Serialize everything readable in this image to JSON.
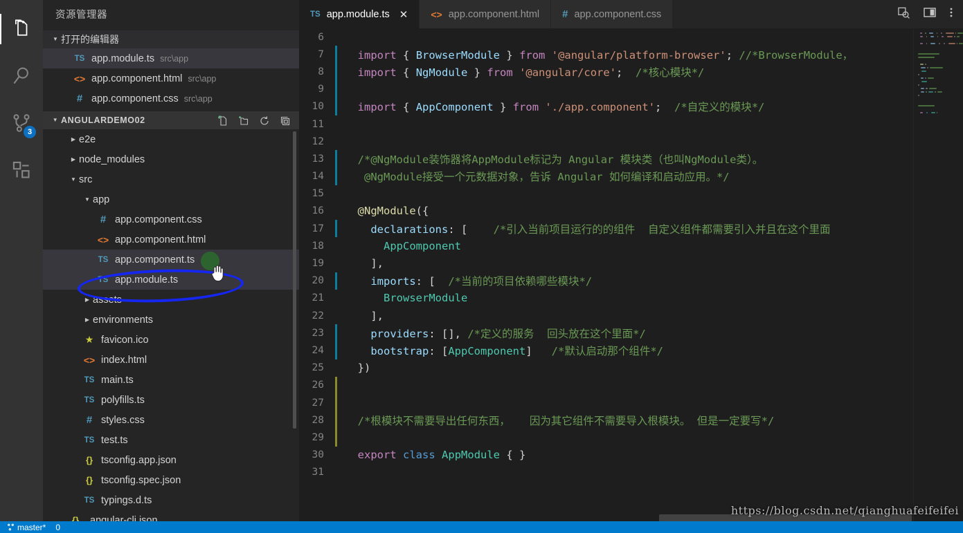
{
  "activity_bar": {
    "items": [
      {
        "name": "explorer",
        "icon": "files-icon",
        "active": true
      },
      {
        "name": "search",
        "icon": "search-icon",
        "active": false
      },
      {
        "name": "source-control",
        "icon": "source-control-icon",
        "active": false,
        "badge": "3"
      },
      {
        "name": "extensions",
        "icon": "extensions-icon",
        "active": false
      }
    ]
  },
  "sidebar": {
    "title": "资源管理器",
    "open_editors": {
      "label": "打开的编辑器",
      "expanded": true,
      "items": [
        {
          "icon": "ts-file-icon",
          "name": "app.module.ts",
          "path": "src\\app",
          "selected": true
        },
        {
          "icon": "html-file-icon",
          "name": "app.component.html",
          "path": "src\\app",
          "selected": false
        },
        {
          "icon": "css-file-icon",
          "name": "app.component.css",
          "path": "src\\app",
          "selected": false
        }
      ]
    },
    "project": {
      "label": "ANGULARDEMO02",
      "expanded": true,
      "actions": [
        "new-file-icon",
        "new-folder-icon",
        "refresh-icon",
        "collapse-all-icon"
      ]
    },
    "tree": [
      {
        "icon": "folder-collapsed",
        "name": "e2e",
        "indent": 1,
        "selected": false
      },
      {
        "icon": "folder-collapsed",
        "name": "node_modules",
        "indent": 1,
        "selected": false
      },
      {
        "icon": "folder-expanded",
        "name": "src",
        "indent": 1,
        "selected": false
      },
      {
        "icon": "folder-expanded",
        "name": "app",
        "indent": 2,
        "selected": false
      },
      {
        "icon": "css-file-icon",
        "name": "app.component.css",
        "indent": 3,
        "selected": false
      },
      {
        "icon": "html-file-icon",
        "name": "app.component.html",
        "indent": 3,
        "selected": false
      },
      {
        "icon": "ts-file-icon",
        "name": "app.component.ts",
        "indent": 3,
        "selected": true
      },
      {
        "icon": "ts-file-icon",
        "name": "app.module.ts",
        "indent": 3,
        "selected": true
      },
      {
        "icon": "folder-collapsed",
        "name": "assets",
        "indent": 2,
        "selected": false
      },
      {
        "icon": "folder-collapsed",
        "name": "environments",
        "indent": 2,
        "selected": false
      },
      {
        "icon": "star-file-icon",
        "name": "favicon.ico",
        "indent": 2,
        "selected": false
      },
      {
        "icon": "html-file-icon",
        "name": "index.html",
        "indent": 2,
        "selected": false
      },
      {
        "icon": "ts-file-icon",
        "name": "main.ts",
        "indent": 2,
        "selected": false
      },
      {
        "icon": "ts-file-icon",
        "name": "polyfills.ts",
        "indent": 2,
        "selected": false
      },
      {
        "icon": "css-file-icon",
        "name": "styles.css",
        "indent": 2,
        "selected": false
      },
      {
        "icon": "ts-file-icon",
        "name": "test.ts",
        "indent": 2,
        "selected": false
      },
      {
        "icon": "json-file-icon",
        "name": "tsconfig.app.json",
        "indent": 2,
        "selected": false
      },
      {
        "icon": "json-file-icon",
        "name": "tsconfig.spec.json",
        "indent": 2,
        "selected": false
      },
      {
        "icon": "ts-file-icon",
        "name": "typings.d.ts",
        "indent": 2,
        "selected": false
      },
      {
        "icon": "json-file-icon",
        "name": ".angular-cli.json",
        "indent": 1,
        "selected": false
      }
    ]
  },
  "editor": {
    "tabs": [
      {
        "icon": "ts-file-icon",
        "label": "app.module.ts",
        "active": true,
        "close": "✕"
      },
      {
        "icon": "html-file-icon",
        "label": "app.component.html",
        "active": false
      },
      {
        "icon": "css-file-icon",
        "label": "app.component.css",
        "active": false
      }
    ],
    "tab_actions": [
      "split-editor-search-icon",
      "split-editor-icon",
      "more-actions-icon"
    ],
    "first_visible_line": 6,
    "code_lines": [
      {
        "n": 6,
        "tokens": []
      },
      {
        "n": 7,
        "dirty": "blue",
        "tokens": [
          {
            "t": "  ",
            "c": "pn"
          },
          {
            "t": "import",
            "c": "k"
          },
          {
            "t": " ",
            "c": "pn"
          },
          {
            "t": "{",
            "c": "pn"
          },
          {
            "t": " ",
            "c": "pn"
          },
          {
            "t": "BrowserModule",
            "c": "id"
          },
          {
            "t": " ",
            "c": "pn"
          },
          {
            "t": "}",
            "c": "pn"
          },
          {
            "t": " ",
            "c": "pn"
          },
          {
            "t": "from",
            "c": "k"
          },
          {
            "t": " ",
            "c": "pn"
          },
          {
            "t": "'@angular/platform-browser'",
            "c": "str"
          },
          {
            "t": ";",
            "c": "pn"
          },
          {
            "t": " //*BrowserModule，",
            "c": "cm"
          }
        ]
      },
      {
        "n": 8,
        "dirty": "blue",
        "tokens": [
          {
            "t": "  ",
            "c": "pn"
          },
          {
            "t": "import",
            "c": "k"
          },
          {
            "t": " ",
            "c": "pn"
          },
          {
            "t": "{",
            "c": "pn"
          },
          {
            "t": " ",
            "c": "pn"
          },
          {
            "t": "NgModule",
            "c": "id"
          },
          {
            "t": " ",
            "c": "pn"
          },
          {
            "t": "}",
            "c": "pn"
          },
          {
            "t": " ",
            "c": "pn"
          },
          {
            "t": "from",
            "c": "k"
          },
          {
            "t": " ",
            "c": "pn"
          },
          {
            "t": "'@angular/core'",
            "c": "str"
          },
          {
            "t": ";",
            "c": "pn"
          },
          {
            "t": "  /*核心模块*/",
            "c": "cm"
          }
        ]
      },
      {
        "n": 9,
        "dirty": "blue",
        "tokens": []
      },
      {
        "n": 10,
        "dirty": "blue",
        "tokens": [
          {
            "t": "  ",
            "c": "pn"
          },
          {
            "t": "import",
            "c": "k"
          },
          {
            "t": " ",
            "c": "pn"
          },
          {
            "t": "{",
            "c": "pn"
          },
          {
            "t": " ",
            "c": "pn"
          },
          {
            "t": "AppComponent",
            "c": "id"
          },
          {
            "t": " ",
            "c": "pn"
          },
          {
            "t": "}",
            "c": "pn"
          },
          {
            "t": " ",
            "c": "pn"
          },
          {
            "t": "from",
            "c": "k"
          },
          {
            "t": " ",
            "c": "pn"
          },
          {
            "t": "'./app.component'",
            "c": "str"
          },
          {
            "t": ";",
            "c": "pn"
          },
          {
            "t": "  /*自定义的模块*/",
            "c": "cm"
          }
        ]
      },
      {
        "n": 11,
        "tokens": []
      },
      {
        "n": 12,
        "tokens": []
      },
      {
        "n": 13,
        "dirty": "blue",
        "tokens": [
          {
            "t": "  /*@NgModule装饰器将AppModule标记为 Angular 模块类（也叫NgModule类）。",
            "c": "cm"
          }
        ]
      },
      {
        "n": 14,
        "dirty": "blue",
        "tokens": [
          {
            "t": "   @NgModule接受一个元数据对象，告诉 Angular 如何编译和启动应用。*/",
            "c": "cm"
          }
        ]
      },
      {
        "n": 15,
        "tokens": []
      },
      {
        "n": 16,
        "tokens": [
          {
            "t": "  ",
            "c": "pn"
          },
          {
            "t": "@NgModule",
            "c": "dec"
          },
          {
            "t": "({",
            "c": "pn"
          }
        ]
      },
      {
        "n": 17,
        "dirty": "blue",
        "tokens": [
          {
            "t": "    ",
            "c": "pn"
          },
          {
            "t": "declarations",
            "c": "id"
          },
          {
            "t": ": [",
            "c": "pn"
          },
          {
            "t": "    /*引入当前项目运行的的组件  自定义组件都需要引入并且在这个里面",
            "c": "cm"
          }
        ]
      },
      {
        "n": 18,
        "tokens": [
          {
            "t": "      ",
            "c": "pn"
          },
          {
            "t": "AppComponent",
            "c": "typ"
          }
        ]
      },
      {
        "n": 19,
        "tokens": [
          {
            "t": "    ],",
            "c": "pn"
          }
        ]
      },
      {
        "n": 20,
        "dirty": "blue",
        "tokens": [
          {
            "t": "    ",
            "c": "pn"
          },
          {
            "t": "imports",
            "c": "id"
          },
          {
            "t": ": [",
            "c": "pn"
          },
          {
            "t": "  /*当前的项目依赖哪些模块*/",
            "c": "cm"
          }
        ]
      },
      {
        "n": 21,
        "tokens": [
          {
            "t": "      ",
            "c": "pn"
          },
          {
            "t": "BrowserModule",
            "c": "typ"
          }
        ]
      },
      {
        "n": 22,
        "tokens": [
          {
            "t": "    ],",
            "c": "pn"
          }
        ]
      },
      {
        "n": 23,
        "dirty": "blue",
        "tokens": [
          {
            "t": "    ",
            "c": "pn"
          },
          {
            "t": "providers",
            "c": "id"
          },
          {
            "t": ": [], ",
            "c": "pn"
          },
          {
            "t": "/*定义的服务  回头放在这个里面*/",
            "c": "cm"
          }
        ]
      },
      {
        "n": 24,
        "dirty": "blue",
        "tokens": [
          {
            "t": "    ",
            "c": "pn"
          },
          {
            "t": "bootstrap",
            "c": "id"
          },
          {
            "t": ": [",
            "c": "pn"
          },
          {
            "t": "AppComponent",
            "c": "typ"
          },
          {
            "t": "]",
            "c": "pn"
          },
          {
            "t": "   /*默认启动那个组件*/",
            "c": "cm"
          }
        ]
      },
      {
        "n": 25,
        "tokens": [
          {
            "t": "  })",
            "c": "pn"
          }
        ]
      },
      {
        "n": 26,
        "dirty": "yellow",
        "tokens": []
      },
      {
        "n": 27,
        "dirty": "yellow",
        "tokens": []
      },
      {
        "n": 28,
        "dirty": "yellow",
        "tokens": [
          {
            "t": "  /*根模块不需要导出任何东西，   因为其它组件不需要导入根模块。 但是一定要写*/",
            "c": "cm"
          }
        ]
      },
      {
        "n": 29,
        "dirty": "yellow",
        "tokens": []
      },
      {
        "n": 30,
        "tokens": [
          {
            "t": "  ",
            "c": "pn"
          },
          {
            "t": "export",
            "c": "k"
          },
          {
            "t": " ",
            "c": "pn"
          },
          {
            "t": "class",
            "c": "kw"
          },
          {
            "t": " ",
            "c": "pn"
          },
          {
            "t": "AppModule",
            "c": "typ"
          },
          {
            "t": " { }",
            "c": "pn"
          }
        ]
      },
      {
        "n": 31,
        "tokens": []
      }
    ]
  },
  "watermark": "https://blog.csdn.net/qianghuafeifeifei",
  "status_bar": {
    "left": [
      "master*",
      "0"
    ],
    "right": []
  },
  "colors": {
    "accent": "#007acc",
    "annotation": "#1526f0",
    "badge": "#0e70c0",
    "editor_bg": "#1e1e1e",
    "sidebar_bg": "#252526",
    "activity_bg": "#333333",
    "comment": "#6a9955",
    "string": "#ce9178",
    "keyword": "#c586c0",
    "type": "#4ec9b0"
  }
}
